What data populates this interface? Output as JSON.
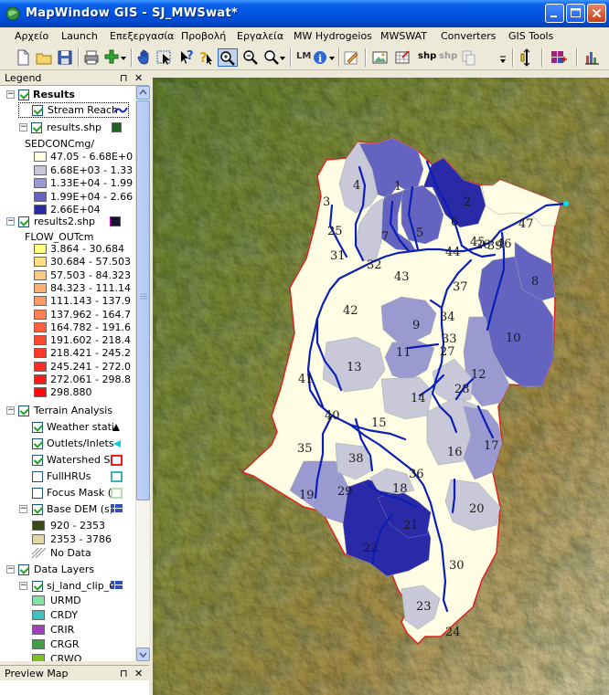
{
  "window": {
    "title": "MapWindow GIS  -  SJ_MWSwat*"
  },
  "menu": [
    "Αρχείο",
    "Launch",
    "Επεξεργασία",
    "Προβολή",
    "Εργαλεία",
    "MW Hydrogeios",
    "MWSWAT",
    "Converters",
    "GIS Tools"
  ],
  "toolbar": {
    "lm_label": "LM",
    "shp_label_1": "shp",
    "shp_label_2": "shp"
  },
  "legend": {
    "title": "Legend",
    "pin": "⊓",
    "close": "✕",
    "groups": {
      "results": {
        "name": "Results",
        "stream_reach": "Stream Reach",
        "results_shp": "results.shp",
        "sedcon_field": "SEDCONCmg/",
        "sedcon_classes": [
          "47.05 - 6.68E+0",
          "6.68E+03 - 1.33",
          "1.33E+04 - 1.99",
          "1.99E+04 - 2.66",
          "2.66E+04"
        ],
        "sedcon_colors": [
          "#ffffe0",
          "#c8c8d8",
          "#9a9ad0",
          "#6464c0",
          "#2a2aa8"
        ],
        "results2_shp": "results2.shp",
        "flow_field": "FLOW_OUTcm",
        "flow_classes": [
          "3.864 - 30.684",
          "30.684 - 57.503",
          "57.503 - 84.323",
          "84.323 - 111.14",
          "111.143 - 137.9",
          "137.962 - 164.7",
          "164.782 - 191.6",
          "191.602 - 218.4",
          "218.421 - 245.2",
          "245.241 - 272.0",
          "272.061 - 298.8",
          "298.880"
        ],
        "flow_colors": [
          "#ffff80",
          "#ffdf80",
          "#ffc880",
          "#ffb070",
          "#ff9a60",
          "#ff8050",
          "#ff6040",
          "#ff4a30",
          "#ff3a2a",
          "#ff2a25",
          "#ff1a1a",
          "#ff0a0a"
        ]
      },
      "terrain": {
        "name": "Terrain Analysis",
        "weather": "Weather stati",
        "outlets": "Outlets/Inlets",
        "watershed": "Watershed Sh",
        "fullhrus": "FullHRUs",
        "focus": "Focus Mask (",
        "dem": "Base  DEM (s)",
        "dem_classes": [
          "920 - 2353",
          "2353 - 3786"
        ],
        "no_data": "No Data"
      },
      "data_layers": {
        "name": "Data Layers",
        "landuse": "sj_land_clip_u",
        "landuse_classes": [
          "URMD",
          "CRDY",
          "CRIR",
          "CRGR",
          "CRWO"
        ],
        "landuse_colors": [
          "#80e0a8",
          "#40c0c0",
          "#a040c0",
          "#40a040",
          "#80c020"
        ]
      }
    }
  },
  "preview": {
    "title": "Preview Map"
  },
  "map": {
    "subbasin_labels": [
      "1",
      "2",
      "3",
      "4",
      "5",
      "6",
      "7",
      "8",
      "9",
      "10",
      "11",
      "12",
      "13",
      "14",
      "15",
      "16",
      "17",
      "18",
      "19",
      "20",
      "21",
      "22",
      "23",
      "24",
      "25",
      "26",
      "27",
      "28",
      "29",
      "30",
      "31",
      "32",
      "33",
      "34",
      "35",
      "36",
      "37",
      "38",
      "39",
      "40",
      "41",
      "42",
      "43",
      "44",
      "45",
      "46",
      "47"
    ]
  }
}
